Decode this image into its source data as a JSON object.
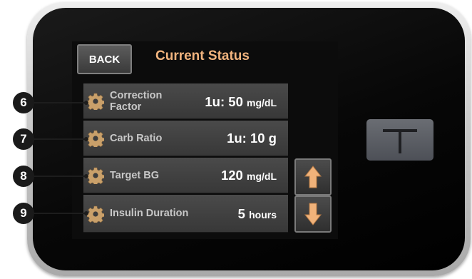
{
  "header": {
    "back_label": "BACK",
    "title": "Current Status"
  },
  "settings": [
    {
      "label_line1": "Correction",
      "label_line2": "Factor",
      "value": "1u: 50",
      "unit": "mg/dL"
    },
    {
      "label": "Carb Ratio",
      "value": "1u: 10 g"
    },
    {
      "label": "Target BG",
      "value": "120",
      "unit": "mg/dL"
    },
    {
      "label": "Insulin Duration",
      "value": "5",
      "unit": "hours"
    }
  ],
  "callouts": [
    "6",
    "7",
    "8",
    "9"
  ],
  "icons": {
    "gear": "gear-icon",
    "scroll_up": "arrow-up-icon",
    "scroll_down": "arrow-down-icon",
    "side_button": "t-logo-icon"
  },
  "colors": {
    "title": "#f2b47e",
    "arrow": "#f0b27a",
    "screen": "#0c0c0c",
    "row": "#404040"
  }
}
